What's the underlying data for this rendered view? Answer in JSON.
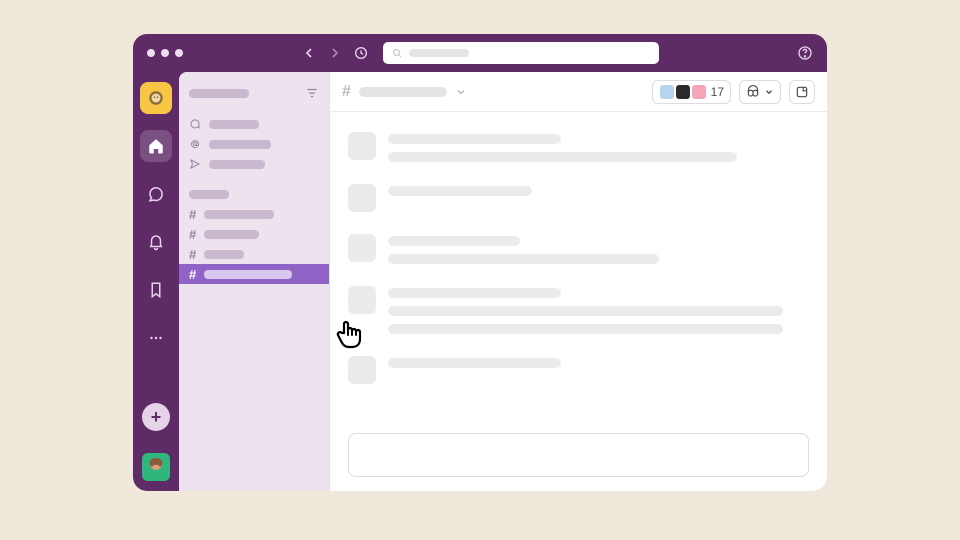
{
  "header": {
    "member_count": "17"
  },
  "icons": {
    "workspace": "workspace-logo",
    "home": "home-icon",
    "dm": "dm-icon",
    "activity": "bell-icon",
    "later": "bookmark-icon",
    "more": "more-icon",
    "add": "+",
    "threads": "threads-icon",
    "mentions": "at-icon",
    "drafts": "send-icon",
    "filter": "filter-icon",
    "history": "clock-icon",
    "search": "search-icon",
    "help": "help-icon",
    "headphones": "huddle-icon",
    "canvas": "canvas-icon",
    "chevron": "chevron-down-icon"
  },
  "sidebar": {
    "channels": [
      {
        "selected": false
      },
      {
        "selected": false
      },
      {
        "selected": false
      },
      {
        "selected": true
      }
    ]
  },
  "channel_prefix": "#"
}
